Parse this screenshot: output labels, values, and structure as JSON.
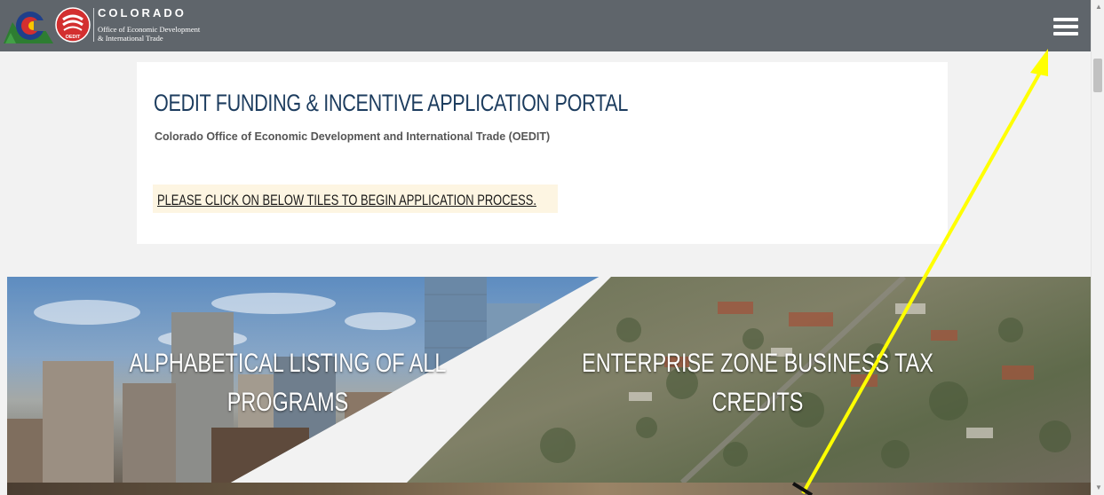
{
  "header": {
    "state_name": "COLORADO",
    "office_line1": "Office of Economic Development",
    "office_line2": "& International Trade",
    "logo_badge": "OEDIT",
    "menu_icon": "hamburger-menu-icon",
    "bar_color": "#5f656b"
  },
  "intro": {
    "title": "OEDIT FUNDING & INCENTIVE APPLICATION PORTAL",
    "subtitle": "Colorado Office of Economic Development and International Trade (OEDIT)",
    "notice": "PLEASE CLICK ON BELOW TILES TO BEGIN APPLICATION PROCESS.",
    "title_color": "#1c3c5e",
    "notice_bg": "#fdf5e2"
  },
  "tiles": [
    {
      "label_line1": "ALPHABETICAL LISTING OF ALL",
      "label_line2": "PROGRAMS"
    },
    {
      "label_line1": "ENTERPRISE ZONE BUSINESS TAX",
      "label_line2": "CREDITS"
    }
  ],
  "annotation": {
    "color": "#ffff00",
    "icon": "annotation-arrow-icon"
  }
}
